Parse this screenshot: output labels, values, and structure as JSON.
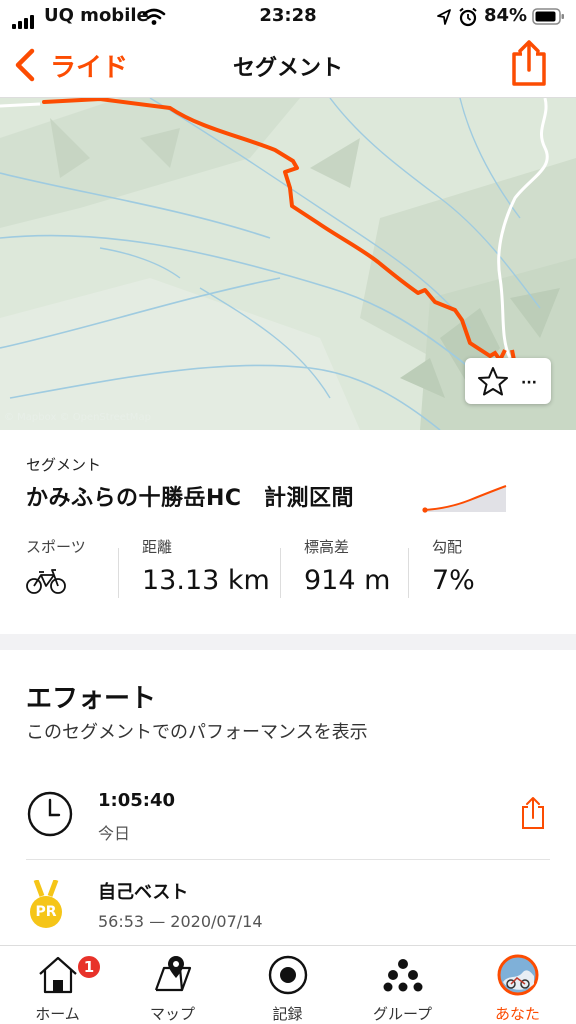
{
  "status_bar": {
    "carrier": "UQ mobile",
    "time": "23:28",
    "battery": "84%"
  },
  "nav": {
    "back_label": "ライド",
    "title": "セグメント"
  },
  "map": {
    "attribution": "© Mapbox © OpenStreetMap",
    "route_color": "#fc4c02"
  },
  "segment": {
    "kind_label": "セグメント",
    "name": "かみふらの十勝岳HC　計測区間",
    "stats": [
      {
        "label": "スポーツ",
        "icon": "bicycle-icon"
      },
      {
        "label": "距離",
        "value": "13.13 km"
      },
      {
        "label": "標高差",
        "value": "914 m"
      },
      {
        "label": "勾配",
        "value": "7%"
      }
    ]
  },
  "effort": {
    "heading": "エフォート",
    "subtitle": "このセグメントでのパフォーマンスを表示",
    "rows": [
      {
        "time": "1:05:40",
        "detail": "今日",
        "icon": "clock-icon"
      },
      {
        "time": "自己ベスト",
        "detail": "56:53 — 2020/07/14",
        "icon": "pr-medal-icon",
        "medal_text": "PR"
      }
    ]
  },
  "tabbar": {
    "tabs": [
      {
        "label": "ホーム",
        "icon": "home-icon",
        "badge": "1"
      },
      {
        "label": "マップ",
        "icon": "map-icon"
      },
      {
        "label": "記録",
        "icon": "record-icon"
      },
      {
        "label": "グループ",
        "icon": "groups-icon"
      },
      {
        "label": "あなた",
        "icon": "avatar",
        "active": true
      }
    ]
  },
  "colors": {
    "accent": "#fc4c02",
    "badge": "#e8322a",
    "medal": "#f5c518"
  }
}
